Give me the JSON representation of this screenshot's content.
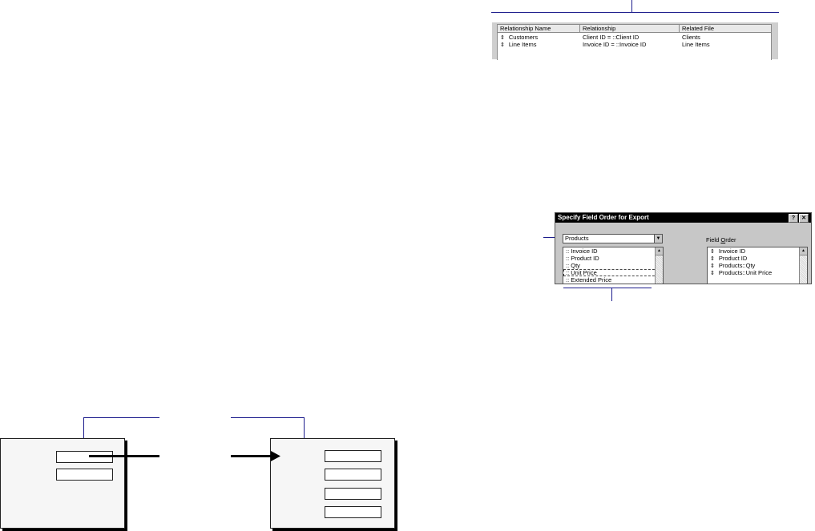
{
  "relationships": {
    "columns": [
      "Relationship Name",
      "Relationship",
      "Related File"
    ],
    "rows": [
      {
        "name": "Customers",
        "relationship": "Client ID = ::Client ID",
        "file": "Clients"
      },
      {
        "name": "Line Items",
        "relationship": "Invoice ID = ::Invoice ID",
        "file": "Line Items"
      }
    ],
    "row_marker": "⇕"
  },
  "export_dialog": {
    "title": "Specify Field Order for Export",
    "help_button": "?",
    "close_button": "✕",
    "file_select_value": "Products",
    "available_fields": [
      ":: Invoice ID",
      ":: Product ID",
      ":: Qty",
      ":: Unit Price",
      ":: Extended Price"
    ],
    "field_order_label_prefix": "Field ",
    "field_order_label_underlined": "O",
    "field_order_label_rest": "rder",
    "field_order": [
      "Invoice ID",
      "Product ID",
      "Products::Qty",
      "Products::Unit Price"
    ],
    "order_marker": "⇕"
  },
  "colors": {
    "callout_line": "#1c1c8c",
    "dialog_bg": "#c7c7c7",
    "title_bar": "#000000"
  }
}
